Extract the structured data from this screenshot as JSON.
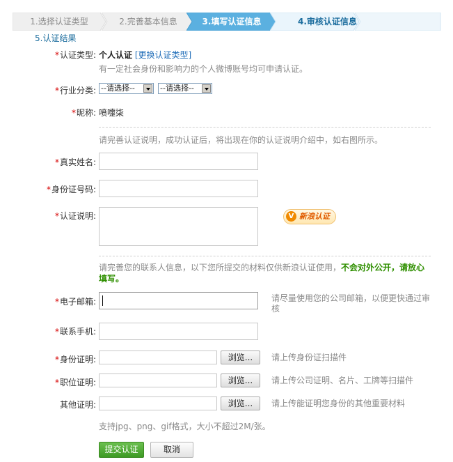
{
  "steps": [
    {
      "label": "1.选择认证类型",
      "state": "done"
    },
    {
      "label": "2.完善基本信息",
      "state": "done"
    },
    {
      "label": "3.填写认证信息",
      "state": "active"
    },
    {
      "label": "4.审核认证信息",
      "state": "next"
    }
  ],
  "step5_label": "5.认证结果",
  "colors": {
    "active_step": "#5bb0e0",
    "step_bg": "#eeeeee",
    "required": "#d60000",
    "link": "#1e6cb8",
    "green_text": "#2f8f00",
    "submit_bg": "#4fae33"
  },
  "auth_type": {
    "label": "认证类型:",
    "value": "个人认证",
    "change_link": "[更换认证类型]",
    "hint": "有一定社会身份和影响力的个人微博账号均可申请认证。"
  },
  "industry": {
    "label": "行业分类:",
    "select1": "--请选择--",
    "select2": "--请选择--"
  },
  "nickname": {
    "label": "昵称:",
    "value": "喷嚏柒"
  },
  "section1_hint": "请完善认证说明，成功认证后，将出现在你的认证说明介绍中，如右图所示。",
  "real_name": {
    "label": "真实姓名:",
    "value": ""
  },
  "id_number": {
    "label": "身份证号码:",
    "value": ""
  },
  "description": {
    "label": "认证说明:",
    "value": ""
  },
  "badge": {
    "icon": "v-icon",
    "text": "新浪认证"
  },
  "section2_hint_plain": "请完善您的联系人信息，以下您所提交的材料仅供新浪认证使用，",
  "section2_hint_green": "不会对外公开，请放心填写。",
  "email": {
    "label": "电子邮箱:",
    "value": "",
    "hint": "请尽量使用您的公司邮箱，以便更快通过审核"
  },
  "phone": {
    "label": "联系手机:",
    "value": ""
  },
  "id_proof": {
    "label": "身份证明:",
    "browse": "浏览...",
    "hint": "请上传身份证扫描件"
  },
  "job_proof": {
    "label": "职位证明:",
    "browse": "浏览...",
    "hint": "请上传公司证明、名片、工牌等扫描件"
  },
  "other_proof": {
    "label": "其他证明:",
    "browse": "浏览...",
    "hint": "请上传能证明您身份的其他重要材料"
  },
  "format_hint": "支持jpg、png、gif格式，大小不超过2M/张。",
  "buttons": {
    "submit": "提交认证",
    "cancel": "取消"
  }
}
